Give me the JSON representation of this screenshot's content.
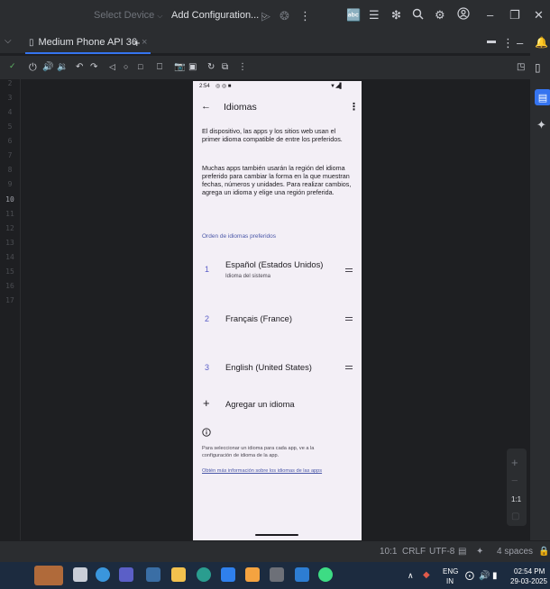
{
  "titlebar": {
    "select_device": "Select Device",
    "add_configuration": "Add Configuration..."
  },
  "device_tab": {
    "label": "Medium Phone API 36",
    "close": "×",
    "add": "+"
  },
  "gutter": {
    "line_numbers": [
      "2",
      "3",
      "4",
      "5",
      "6",
      "7",
      "8",
      "9",
      "10",
      "11",
      "12",
      "13",
      "14",
      "15",
      "16",
      "17"
    ]
  },
  "phone": {
    "status_time": "2:54",
    "title": "Idiomas",
    "para1": "El dispositivo, las apps y los sitios web usan el primer idioma compatible de entre los preferidos.",
    "para2": "Muchas apps también usarán la región del idioma preferido para cambiar la forma en la que muestran fechas, números y unidades. Para realizar cambios, agrega un idioma y elige una región preferida.",
    "section_header": "Orden de idiomas preferidos",
    "languages": [
      {
        "num": "1",
        "name": "Español (Estados Unidos)",
        "sub": "Idioma del sistema"
      },
      {
        "num": "2",
        "name": "Français (France)",
        "sub": ""
      },
      {
        "num": "3",
        "name": "English (United States)",
        "sub": ""
      }
    ],
    "add_language": "Agregar un idioma",
    "footer_text": "Para seleccionar un idioma para cada app, ve a la configuración de idioma de la app.",
    "footer_link": "Obtén más información sobre los idiomas de las apps"
  },
  "zoom": {
    "plus": "+",
    "minus": "−",
    "one_to_one": "1:1"
  },
  "statusbar": {
    "position": "10:1",
    "line_ending": "CRLF",
    "encoding": "UTF-8",
    "indent": "4 spaces"
  },
  "taskbar": {
    "lang_top": "ENG",
    "lang_bottom": "IN",
    "time": "02:54 PM",
    "date": "29-03-2025"
  },
  "colors": {
    "accent": "#3574f0",
    "phone_bg": "#f3eff6",
    "link": "#4a57a8"
  }
}
